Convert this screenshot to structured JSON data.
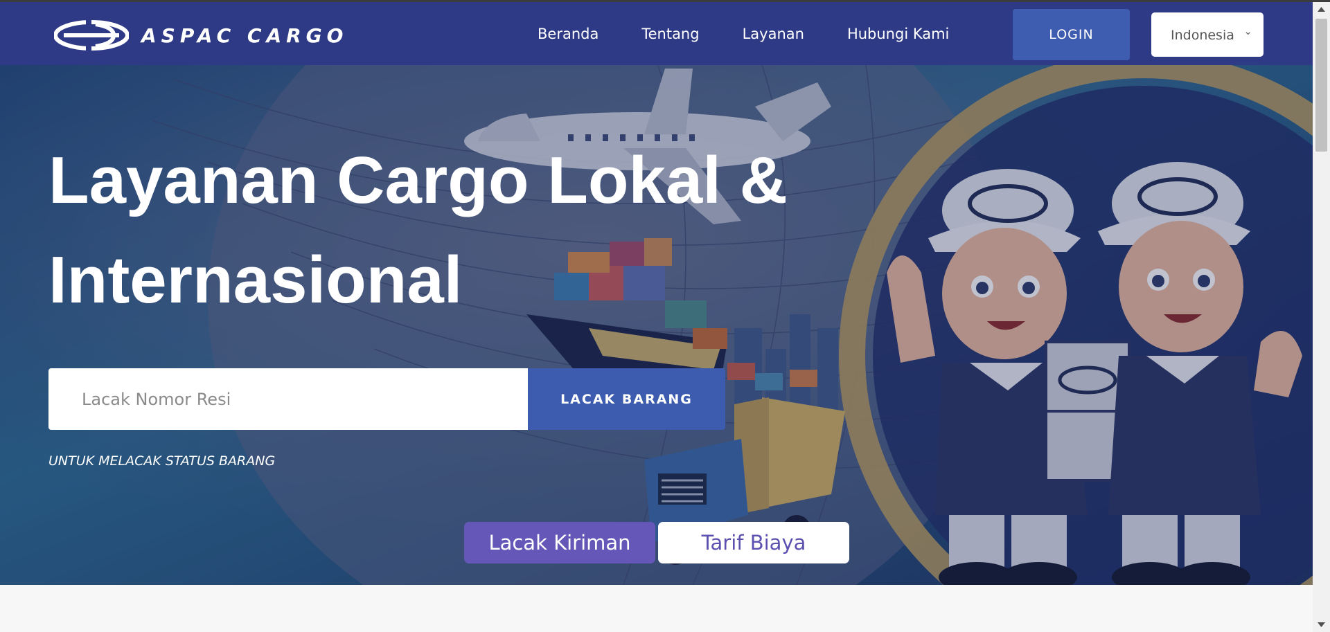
{
  "brand": {
    "name": "ASPAC CARGO",
    "logo_icon": "aspac-logo-mark"
  },
  "nav": {
    "links": [
      {
        "label": "Beranda"
      },
      {
        "label": "Tentang"
      },
      {
        "label": "Layanan"
      },
      {
        "label": "Hubungi Kami"
      }
    ],
    "login_label": "LOGIN",
    "language": {
      "selected": "Indonesia",
      "icon": "chevron-down-icon"
    }
  },
  "hero": {
    "title": "Layanan Cargo Lokal & Internasional",
    "track_placeholder": "Lacak Nomor Resi",
    "track_value": "",
    "track_button": "LACAK BARANG",
    "track_hint": "UNTUK MELACAK STATUS BARANG",
    "tabs": [
      {
        "label": "Lacak Kiriman",
        "active": true
      },
      {
        "label": "Tarif Biaya",
        "active": false
      }
    ]
  },
  "colors": {
    "navbar": "#2f3a86",
    "accent": "#3e5caf",
    "tab_active": "#6557b8",
    "tab_inactive_text": "#5b4fb0",
    "gold_ring": "#b79d60"
  }
}
